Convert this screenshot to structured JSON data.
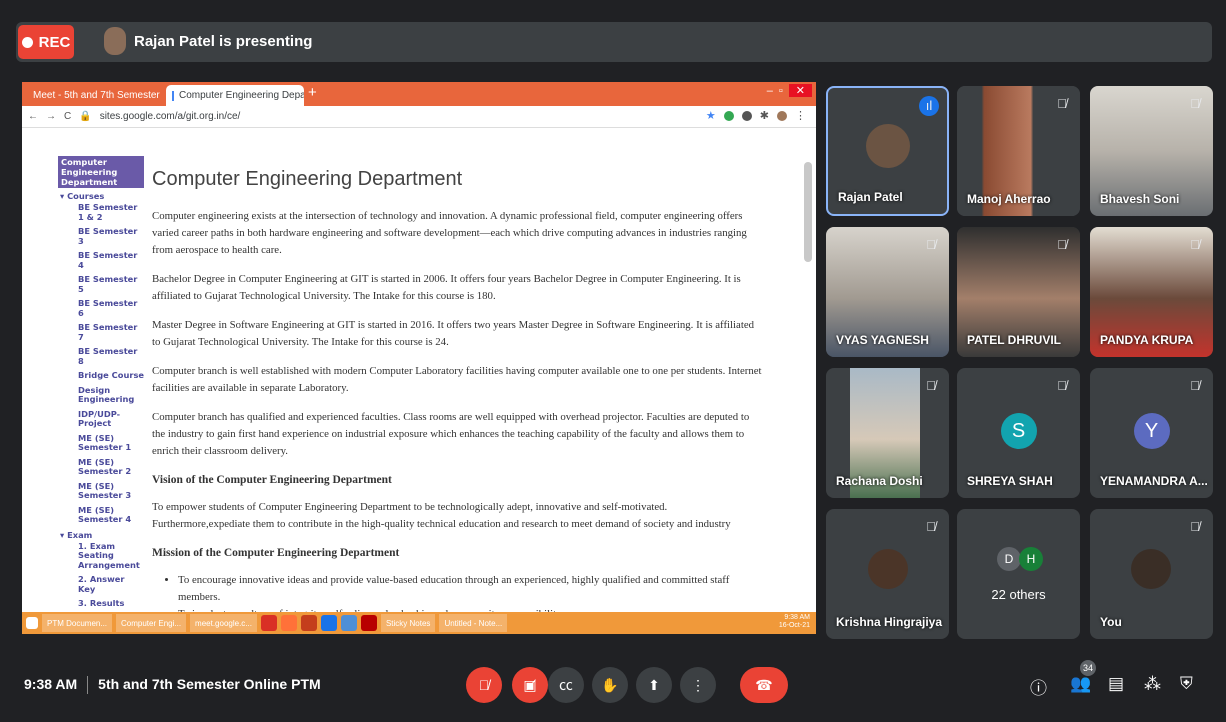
{
  "top_bar": {
    "rec_label": "REC",
    "presenting": "Rajan Patel is presenting"
  },
  "browser": {
    "tabs": [
      "Meet - 5th and 7th Semester",
      "Computer Engineering Departm"
    ],
    "url": "sites.google.com/a/git.org.in/ce/"
  },
  "site": {
    "nav_selected": "Computer Engineering Department",
    "nav_courses": "Courses",
    "nav_course_items": [
      "BE Semester 1 & 2",
      "BE Semester 3",
      "BE Semester 4",
      "BE Semester 5",
      "BE Semester 6",
      "BE Semester 7",
      "BE Semester 8",
      "Bridge Course",
      "Design Engineering",
      "IDP/UDP-Project",
      "ME (SE) Semester 1",
      "ME (SE) Semester 2",
      "ME (SE) Semester 3",
      "ME (SE) Semester 4"
    ],
    "nav_exam": "Exam",
    "nav_exam_items": [
      "1. Exam Seating Arrangement",
      "2. Answer Key",
      "3. Results"
    ],
    "title": "Computer Engineering Department",
    "paragraphs": [
      "Computer engineering exists at the intersection of technology and innovation. A dynamic professional field, computer engineering offers varied career paths in both hardware engineering and software development—each which drive computing advances in industries ranging from aerospace to health care.",
      "Bachelor Degree in Computer Engineering at GIT is started in 2006. It offers four years Bachelor Degree in Computer Engineering. It is affiliated to Gujarat Technological University. The Intake for this course is 180.",
      "Master Degree in Software Engineering at GIT is started in 2016. It offers two years Master Degree in Software Engineering. It is affiliated to Gujarat Technological University. The Intake for this course is 24.",
      "Computer branch is well established with modern Computer Laboratory facilities having computer available one to one per students. Internet facilities are available in separate Laboratory.",
      "Computer branch has qualified and experienced faculties. Class rooms are well equipped with overhead projector. Faculties are deputed to the industry to gain first hand experience on industrial exposure which enhances the teaching capability of the faculty and allows them to enrich their classroom delivery."
    ],
    "vision_heading": "Vision of the Computer Engineering Department",
    "vision_text": "To empower students of Computer Engineering Department to be technologically adept, innovative and self-motivated. Furthermore,expediate them to contribute in the high-quality technical education and research to meet demand of society and industry",
    "mission_heading": "Mission of the Computer Engineering  Department",
    "mission_items": [
      "To encourage innovative ideas and provide value-based education through an experienced, highly qualified and committed staff members.",
      "To inculcate a culture of integrity, self-reliance, leadership and community responsibility."
    ]
  },
  "taskbar": {
    "items": [
      "PTM Documen...",
      "Computer Engi...",
      "meet.google.c...",
      "Sticky Notes",
      "Untitled - Note..."
    ],
    "time": "9:38 AM",
    "date": "16-Oct-21"
  },
  "participants": [
    {
      "name": "Rajan Patel",
      "speaking": true
    },
    {
      "name": "Manoj Aherrao"
    },
    {
      "name": "Bhavesh Soni"
    },
    {
      "name": "VYAS YAGNESH"
    },
    {
      "name": "PATEL DHRUVIL"
    },
    {
      "name": "PANDYA KRUPA"
    },
    {
      "name": "Rachana Doshi"
    },
    {
      "name": "SHREYA SHAH",
      "initial": "S",
      "color": "#12a4af"
    },
    {
      "name": "YENAMANDRA A...",
      "initial": "Y",
      "color": "#5c6bc0"
    },
    {
      "name": "Krishna Hingrajiya"
    },
    {
      "name": "22 others",
      "initials": [
        "D",
        "H"
      ]
    },
    {
      "name": "You"
    }
  ],
  "bottom": {
    "time": "9:38 AM",
    "meeting_title": "5th and 7th Semester Online PTM",
    "participant_count": "34"
  }
}
